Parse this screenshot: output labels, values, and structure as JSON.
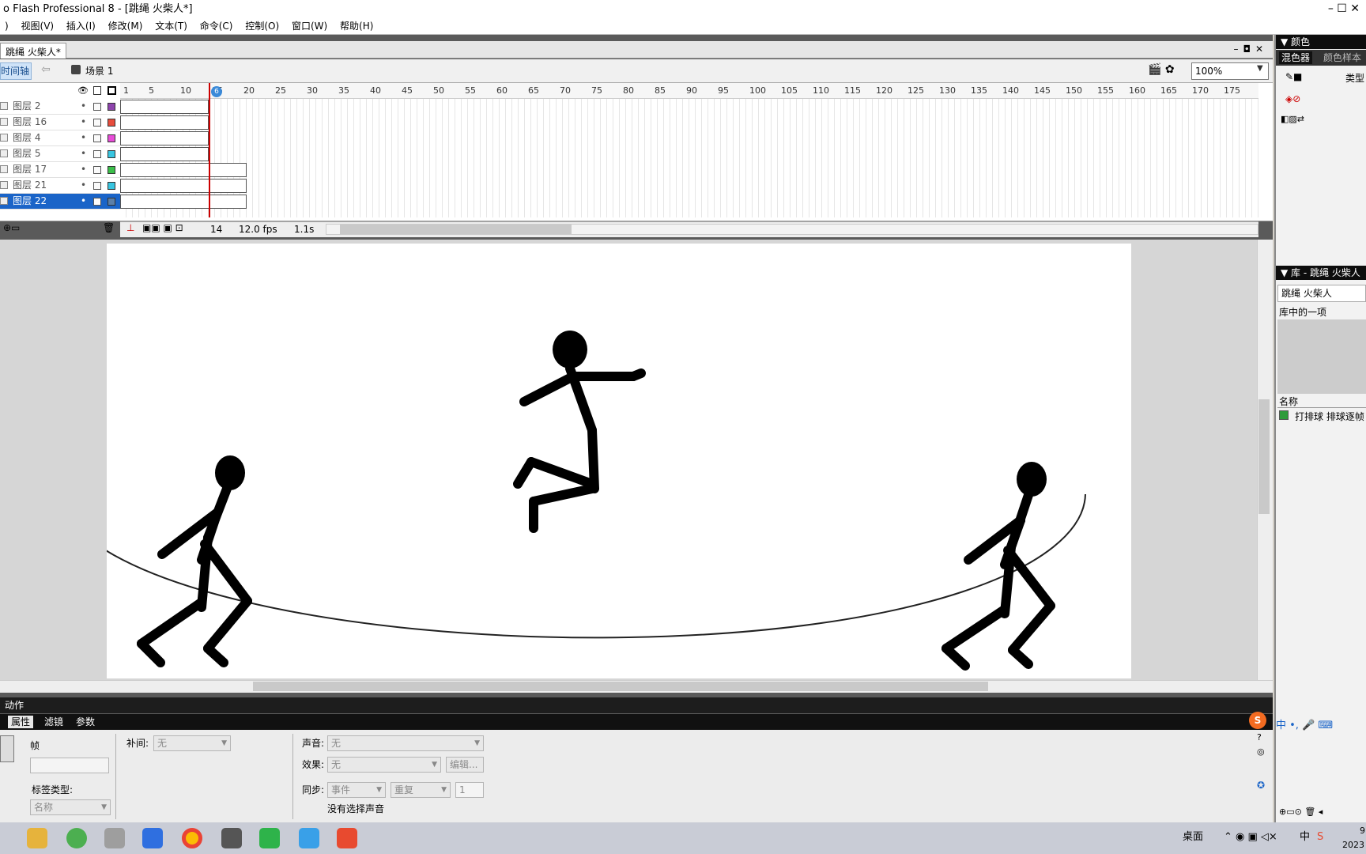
{
  "window": {
    "title": "o Flash Professional 8 - [跳绳 火柴人*]",
    "controls": "–  ☐  ✕"
  },
  "menu": [
    ")",
    "视图(V)",
    "插入(I)",
    "修改(M)",
    "文本(T)",
    "命令(C)",
    "控制(O)",
    "窗口(W)",
    "帮助(H)"
  ],
  "document": {
    "tab": "跳绳 火柴人*",
    "controls": "–◘✕"
  },
  "scenebar": {
    "timeline_btn": "时间轴",
    "scene": "场景 1",
    "zoom": "100%"
  },
  "timeline": {
    "ruler": [
      "1",
      "5",
      "10",
      "15",
      "20",
      "25",
      "30",
      "35",
      "40",
      "45",
      "50",
      "55",
      "60",
      "65",
      "70",
      "75",
      "80",
      "85",
      "90",
      "95",
      "100",
      "105",
      "110",
      "115",
      "120",
      "125",
      "130",
      "135",
      "140",
      "145",
      "150",
      "155",
      "160",
      "165",
      "170",
      "175"
    ],
    "layers": [
      {
        "name": "图层 2",
        "color": "#8e44ad",
        "frames": 14,
        "selected": false
      },
      {
        "name": "图层 16",
        "color": "#e74c3c",
        "frames": 14,
        "selected": false
      },
      {
        "name": "图层 4",
        "color": "#e84dd8",
        "frames": 14,
        "selected": false
      },
      {
        "name": "图层 5",
        "color": "#38c5e0",
        "frames": 14,
        "selected": false
      },
      {
        "name": "图层 17",
        "color": "#3bbf4a",
        "frames": 20,
        "selected": false
      },
      {
        "name": "图层 21",
        "color": "#38c5e0",
        "frames": 20,
        "selected": false
      },
      {
        "name": "图层 22",
        "color": "#5b7fa8",
        "frames": 20,
        "selected": true
      }
    ],
    "playhead_frame": "14",
    "fps": "12.0 fps",
    "time": "1.1s"
  },
  "panels": {
    "actions": "动作",
    "tabs": [
      "属性",
      "滤镜",
      "参数"
    ],
    "props": {
      "frame_label": "帧",
      "tween_label": "补间:",
      "tween_value": "无",
      "sound_label": "声音:",
      "sound_value": "无",
      "effect_label": "效果:",
      "effect_value": "无",
      "edit_btn": "编辑...",
      "label_type": "标签类型:",
      "label_type_value": "名称",
      "sync_label": "同步:",
      "sync_value": "事件",
      "repeat_value": "重复",
      "repeat_count": "1",
      "no_sound": "没有选择声音"
    }
  },
  "right": {
    "color_title": "▼ 颜色",
    "color_tabs": [
      "混色器",
      "颜色样本"
    ],
    "type_label": "类型",
    "library_title": "▼ 库 - 跳绳 火柴人",
    "library_select": "跳绳 火柴人",
    "library_count": "库中的一项",
    "name_header": "名称",
    "item": "打排球 排球逐帧"
  },
  "taskbar": {
    "desktop": "桌面",
    "ime": "中",
    "time": "9",
    "year": "2023"
  }
}
